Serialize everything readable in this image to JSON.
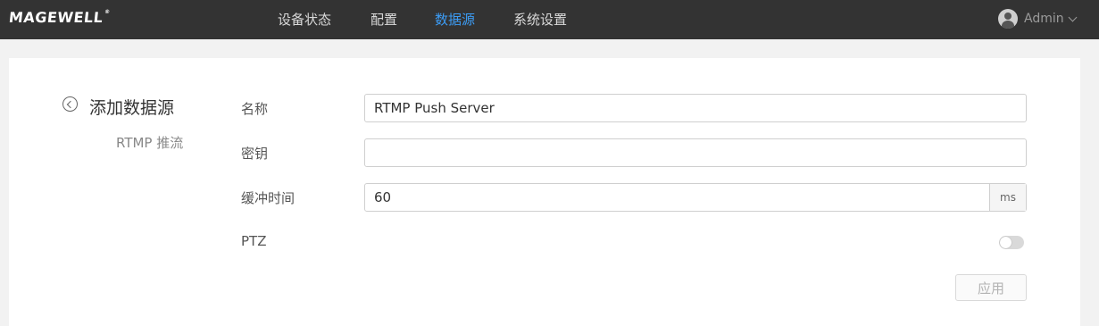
{
  "header": {
    "brand": "MAGEWELL",
    "brand_mark": "®",
    "nav": [
      {
        "label": "设备状态",
        "active": false
      },
      {
        "label": "配置",
        "active": false
      },
      {
        "label": "数据源",
        "active": true
      },
      {
        "label": "系统设置",
        "active": false
      }
    ],
    "user": {
      "name": "Admin",
      "icon": "user-avatar-icon"
    }
  },
  "side": {
    "back_icon": "chevron-left-circle-icon",
    "title": "添加数据源",
    "subtitle": "RTMP 推流"
  },
  "form": {
    "name": {
      "label": "名称",
      "value": "RTMP Push Server",
      "placeholder": ""
    },
    "key": {
      "label": "密钥",
      "value": "",
      "placeholder": ""
    },
    "buffer": {
      "label": "缓冲时间",
      "value": "60",
      "unit": "ms"
    },
    "ptz": {
      "label": "PTZ",
      "enabled": false
    },
    "apply_label": "应用"
  },
  "colors": {
    "topbar": "#333333",
    "active_nav": "#3c9cf5",
    "background": "#f2f2f2"
  }
}
